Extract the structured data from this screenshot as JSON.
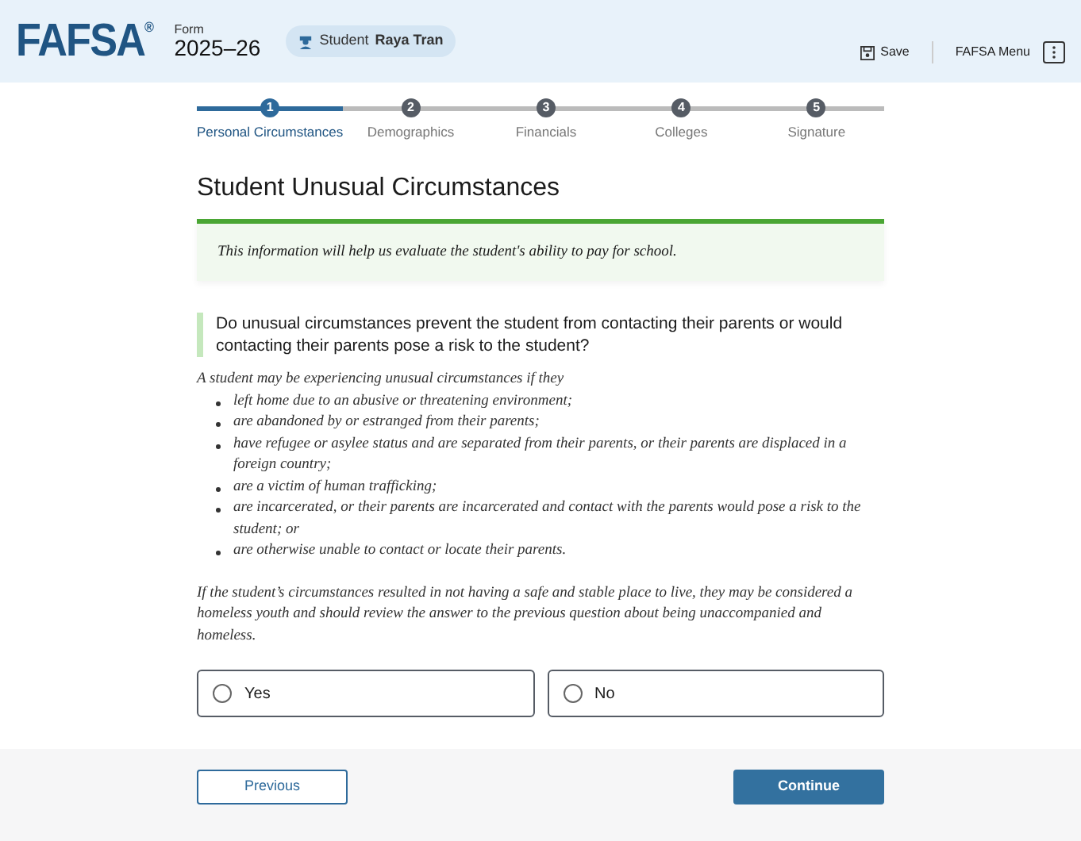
{
  "header": {
    "logo": "FAFSA",
    "logo_mark": "®",
    "form_label": "Form",
    "form_year": "2025–26",
    "user_role": "Student",
    "user_name": "Raya Tran",
    "save": "Save",
    "menu": "FAFSA Menu"
  },
  "steps": [
    {
      "number": "1",
      "label": "Personal Circumstances",
      "selected": true
    },
    {
      "number": "2",
      "label": "Demographics",
      "selected": false
    },
    {
      "number": "3",
      "label": "Financials",
      "selected": false
    },
    {
      "number": "4",
      "label": "Colleges",
      "selected": false
    },
    {
      "number": "5",
      "label": "Signature",
      "selected": false
    }
  ],
  "title": "Student Unusual Circumstances",
  "info": "This information will help us evaluate the student's ability to pay for school.",
  "question": "Do unusual circumstances prevent the student from contacting their parents or would contacting their parents pose a risk to the student?",
  "intro": "A student may be experiencing unusual circumstances if they",
  "bullets": [
    "left home due to an abusive or threatening environment;",
    "are abandoned by or estranged from their parents;",
    "have refugee or asylee status and are separated from their parents, or their parents are displaced in a foreign country;",
    "are a victim of human trafficking;",
    "are incarcerated, or their parents are incarcerated and contact with the parents would pose a risk to the student; or",
    "are otherwise unable to contact or locate their parents."
  ],
  "note": "If the student’s circumstances resulted in not having a safe and stable place to live, they may be considered a homeless youth and should review the answer to the previous question about being unaccompanied and homeless.",
  "options": [
    {
      "label": "Yes",
      "selected": false
    },
    {
      "label": "No",
      "selected": false
    }
  ],
  "buttons": {
    "previous": "Previous",
    "continue": "Continue"
  }
}
